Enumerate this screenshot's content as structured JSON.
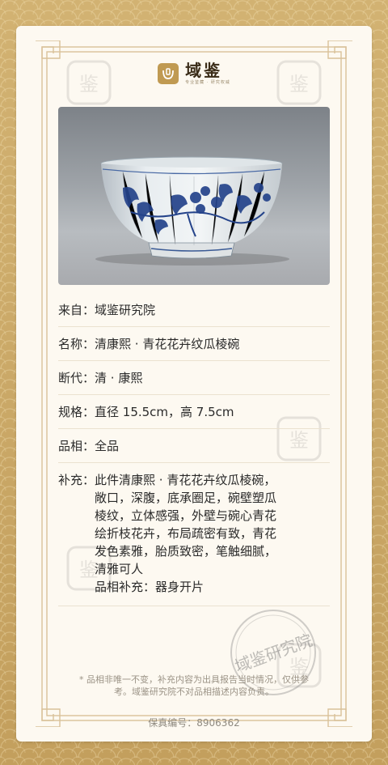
{
  "brand": {
    "name": "域鉴",
    "slogan": "专业鉴藏 · 研究权威",
    "watermark_text": "域鉴"
  },
  "fields": [
    {
      "label": "来自：",
      "value": "域鉴研究院"
    },
    {
      "label": "名称：",
      "value": "清康熙 · 青花花卉纹瓜棱碗"
    },
    {
      "label": "断代：",
      "value": "清 · 康熙"
    },
    {
      "label": "规格：",
      "value": "直径 15.5cm，高 7.5cm"
    },
    {
      "label": "品相：",
      "value": "全品"
    }
  ],
  "supplement": {
    "label": "补充：",
    "lines": [
      "此件清康熙 · 青花花卉纹瓜棱碗，",
      "敞口，深腹，底承圈足，碗壁塑瓜",
      "棱纹，立体感强，外壁与碗心青花",
      "绘折枝花卉，布局疏密有致，青花",
      "发色素雅，胎质致密，笔触细腻，",
      "清雅可人",
      "品相补充：器身开片"
    ]
  },
  "disclaimer": "* 品相非唯一不变，补充内容为出具报告当时情况，仅供参考。域鉴研究院不对品相描述内容负责。",
  "serial": "保真编号：8906362",
  "stamp_text": "域鉴研究院",
  "colors": {
    "gold": "#c09a52",
    "card": "#fdf9f1",
    "frame": "#d4b98a"
  }
}
